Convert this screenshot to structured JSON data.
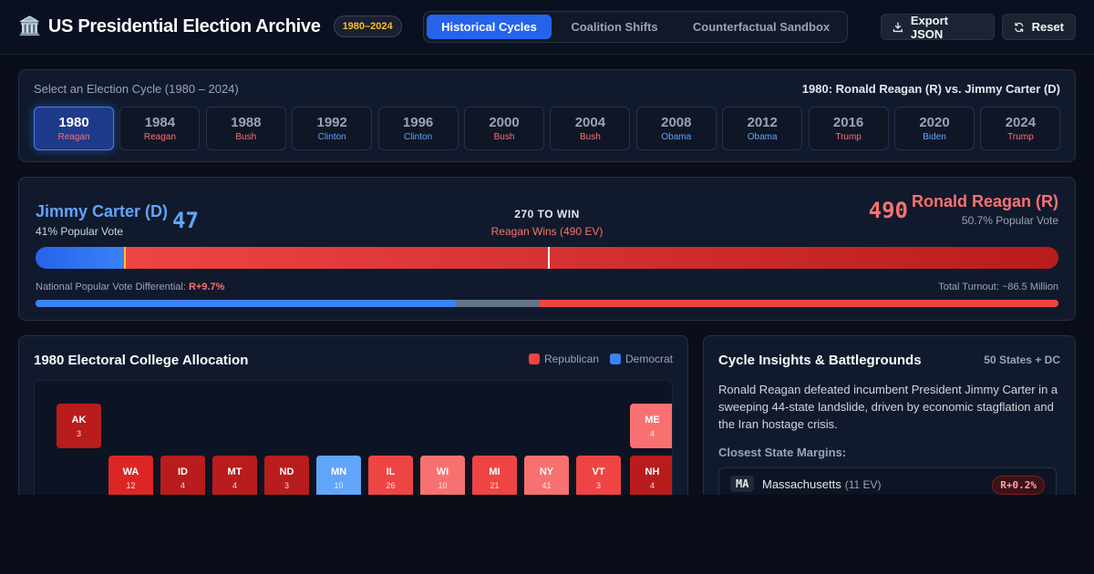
{
  "header": {
    "icon": "🏛️",
    "title": "US Presidential Election Archive",
    "range_badge": "1980–2024",
    "tabs": [
      {
        "label": "Historical Cycles",
        "active": true
      },
      {
        "label": "Coalition Shifts",
        "active": false
      },
      {
        "label": "Counterfactual Sandbox",
        "active": false
      }
    ],
    "export_label": "Export JSON",
    "export_icon": "download-icon",
    "reset_label": "Reset",
    "reset_icon": "refresh-icon"
  },
  "cycles": {
    "label": "Select an Election Cycle (1980 – 2024)",
    "matchup": "1980: Ronald Reagan (R) vs. Jimmy Carter (D)",
    "years": [
      {
        "year": "1980",
        "winner": "Reagan",
        "party": "R",
        "active": true
      },
      {
        "year": "1984",
        "winner": "Reagan",
        "party": "R"
      },
      {
        "year": "1988",
        "winner": "Bush",
        "party": "R"
      },
      {
        "year": "1992",
        "winner": "Clinton",
        "party": "D"
      },
      {
        "year": "1996",
        "winner": "Clinton",
        "party": "D"
      },
      {
        "year": "2000",
        "winner": "Bush",
        "party": "R"
      },
      {
        "year": "2004",
        "winner": "Bush",
        "party": "R"
      },
      {
        "year": "2008",
        "winner": "Obama",
        "party": "D"
      },
      {
        "year": "2012",
        "winner": "Obama",
        "party": "D"
      },
      {
        "year": "2016",
        "winner": "Trump",
        "party": "R"
      },
      {
        "year": "2020",
        "winner": "Biden",
        "party": "D"
      },
      {
        "year": "2024",
        "winner": "Trump",
        "party": "R"
      }
    ]
  },
  "results": {
    "dem_name": "Jimmy Carter (D)",
    "dem_ev": "47",
    "dem_pop": "41% Popular Vote",
    "rep_name": "Ronald Reagan (R)",
    "rep_ev": "490",
    "rep_pop": "50.7% Popular Vote",
    "to_win": "270 TO WIN",
    "outcome": "Reagan Wins (490 EV)",
    "ev_dem_value": 47,
    "ev_rep_value": 490,
    "ev_total": 538,
    "ev_threshold": 270,
    "diff_label": "National Popular Vote Differential:",
    "diff_value": "R+9.7%",
    "turnout": "Total Turnout: ~86.5 Million",
    "pop_dem_share": 41,
    "pop_rep_share": 50.7
  },
  "map": {
    "title": "1980 Electoral College Allocation",
    "legend_rep": "Republican",
    "legend_dem": "Democrat",
    "colors": {
      "rep": "#ef4444",
      "dem": "#3b82f6"
    },
    "states": [
      {
        "abbr": "AK",
        "ev": "3",
        "color": "#b91c1c"
      },
      {
        "abbr": "ME",
        "ev": "4",
        "color": "#f87171"
      },
      {
        "abbr": "WA",
        "ev": "12",
        "color": "#dc2626"
      },
      {
        "abbr": "ID",
        "ev": "4",
        "color": "#b91c1c"
      },
      {
        "abbr": "MT",
        "ev": "4",
        "color": "#b91c1c"
      },
      {
        "abbr": "ND",
        "ev": "3",
        "color": "#b91c1c"
      },
      {
        "abbr": "MN",
        "ev": "10",
        "color": "#60a5fa"
      },
      {
        "abbr": "IL",
        "ev": "26",
        "color": "#ef4444"
      },
      {
        "abbr": "WI",
        "ev": "10",
        "color": "#f87171"
      },
      {
        "abbr": "MI",
        "ev": "21",
        "color": "#ef4444"
      },
      {
        "abbr": "NY",
        "ev": "41",
        "color": "#f87171"
      },
      {
        "abbr": "VT",
        "ev": "3",
        "color": "#ef4444"
      },
      {
        "abbr": "NH",
        "ev": "4",
        "color": "#b91c1c"
      }
    ]
  },
  "insights": {
    "title": "Cycle Insights & Battlegrounds",
    "count": "50 States + DC",
    "text": "Ronald Reagan defeated incumbent President Jimmy Carter in a sweeping 44-state landslide, driven by economic stagflation and the Iran hostage crisis.",
    "margins_label": "Closest State Margins:",
    "margins": [
      {
        "code": "MA",
        "name": "Massachusetts",
        "ev": "(11 EV)",
        "margin": "R+0.2%"
      }
    ]
  }
}
